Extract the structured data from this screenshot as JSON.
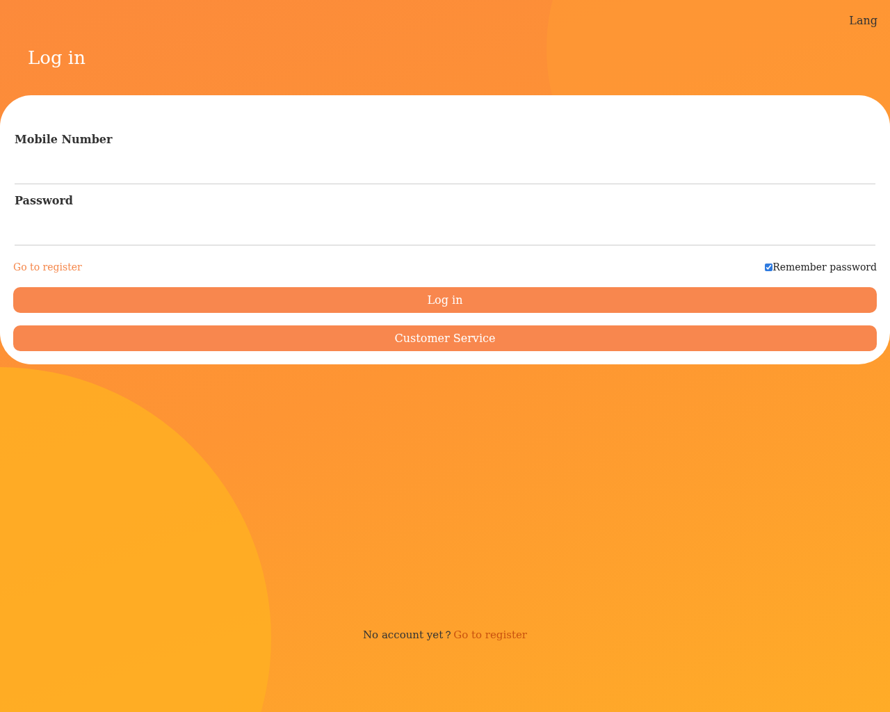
{
  "header": {
    "lang": "Lang",
    "title": "Log in"
  },
  "fields": [
    {
      "label": "Mobile Number"
    },
    {
      "label": "Password"
    }
  ],
  "register_link": "Go to register",
  "remember": {
    "label": "Remember password",
    "checked": true
  },
  "buttons": [
    "Log in",
    "Customer Service"
  ],
  "footer": {
    "text": "No account yet？",
    "link": "Go to register"
  }
}
